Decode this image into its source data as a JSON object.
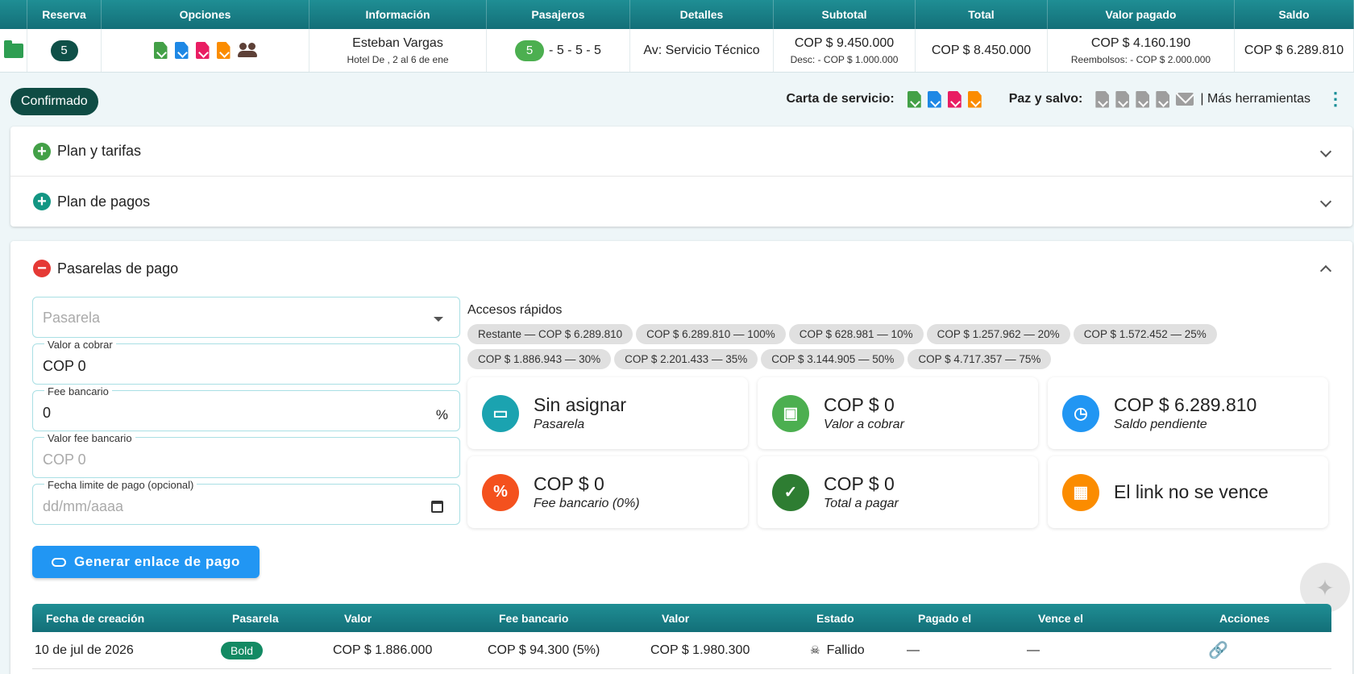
{
  "top_table": {
    "headers": [
      "Reserva",
      "Opciones",
      "Información",
      "Pasajeros",
      "Detalles",
      "Subtotal",
      "Total",
      "Valor pagado",
      "Saldo"
    ],
    "reserva": "5",
    "info_name": "Esteban Vargas",
    "info_sub": "Hotel De , 2 al 6 de ene",
    "pax_badge": "5",
    "pax_rest": "- 5 - 5 - 5",
    "detalles": "Av: Servicio Técnico",
    "subtotal": "COP $ 9.450.000",
    "subtotal_desc": "Desc: - COP $ 1.000.000",
    "total": "COP $ 8.450.000",
    "valor_pagado": "COP $ 4.160.190",
    "reembolsos": "Reembolsos: - COP $ 2.000.000",
    "saldo": "COP $ 6.289.810"
  },
  "toolbar": {
    "status": "Confirmado",
    "carta_label": "Carta de servicio:",
    "paz_label": "Paz y salvo:",
    "mas_label": "| Más herramientas"
  },
  "accordion": {
    "plan_tarifas": "Plan y tarifas",
    "plan_pagos": "Plan de pagos",
    "pasarelas": "Pasarelas de pago"
  },
  "form": {
    "pasarela_placeholder": "Pasarela",
    "valor_label": "Valor a cobrar",
    "valor_value": "COP 0",
    "fee_label": "Fee bancario",
    "fee_value": "0",
    "fee_unit": "%",
    "valor_fee_label": "Valor fee bancario",
    "valor_fee_placeholder": "COP 0",
    "fecha_label": "Fecha limite de pago (opcional)",
    "fecha_placeholder": "dd/mm/aaaa",
    "generate_label": "Generar enlace de pago"
  },
  "quick": {
    "title": "Accesos rápidos",
    "chips": [
      "Restante — COP $ 6.289.810",
      "COP $ 6.289.810 — 100%",
      "COP $ 628.981 — 10%",
      "COP $ 1.257.962 — 20%",
      "COP $ 1.572.452 — 25%",
      "COP $ 1.886.943 — 30%",
      "COP $ 2.201.433 — 35%",
      "COP $ 3.144.905 — 50%",
      "COP $ 4.717.357 — 75%"
    ]
  },
  "cards": [
    {
      "big": "Sin asignar",
      "sub": "Pasarela",
      "icon": "card-icon",
      "color": "#1ba3b0"
    },
    {
      "big": "COP $ 0",
      "sub": "Valor a cobrar",
      "icon": "cash-icon",
      "color": "#4caf50"
    },
    {
      "big": "COP $ 6.289.810",
      "sub": "Saldo pendiente",
      "icon": "clock-money-icon",
      "color": "#2196f3"
    },
    {
      "big": "COP $ 0",
      "sub": "Fee bancario (0%)",
      "icon": "percent-icon",
      "color": "#f4511e"
    },
    {
      "big": "COP $ 0",
      "sub": "Total a pagar",
      "icon": "cash-check-icon",
      "color": "#2e7d32"
    },
    {
      "big": "El link no se vence",
      "sub": "",
      "icon": "calendar-clock-icon",
      "color": "#fb8c00"
    }
  ],
  "bottom_table": {
    "headers": [
      "Fecha de creación",
      "Pasarela",
      "Valor",
      "Fee bancario",
      "Valor",
      "Estado",
      "Pagado el",
      "Vence el",
      "Acciones"
    ],
    "rows": [
      {
        "fecha": "10 de jul de 2026",
        "pasarela": "Bold",
        "valor": "COP $ 1.886.000",
        "fee": "COP $ 94.300 (5%)",
        "valor_total": "COP $ 1.980.300",
        "estado": "Fallido",
        "pagado": "—",
        "vence": "—"
      }
    ]
  }
}
